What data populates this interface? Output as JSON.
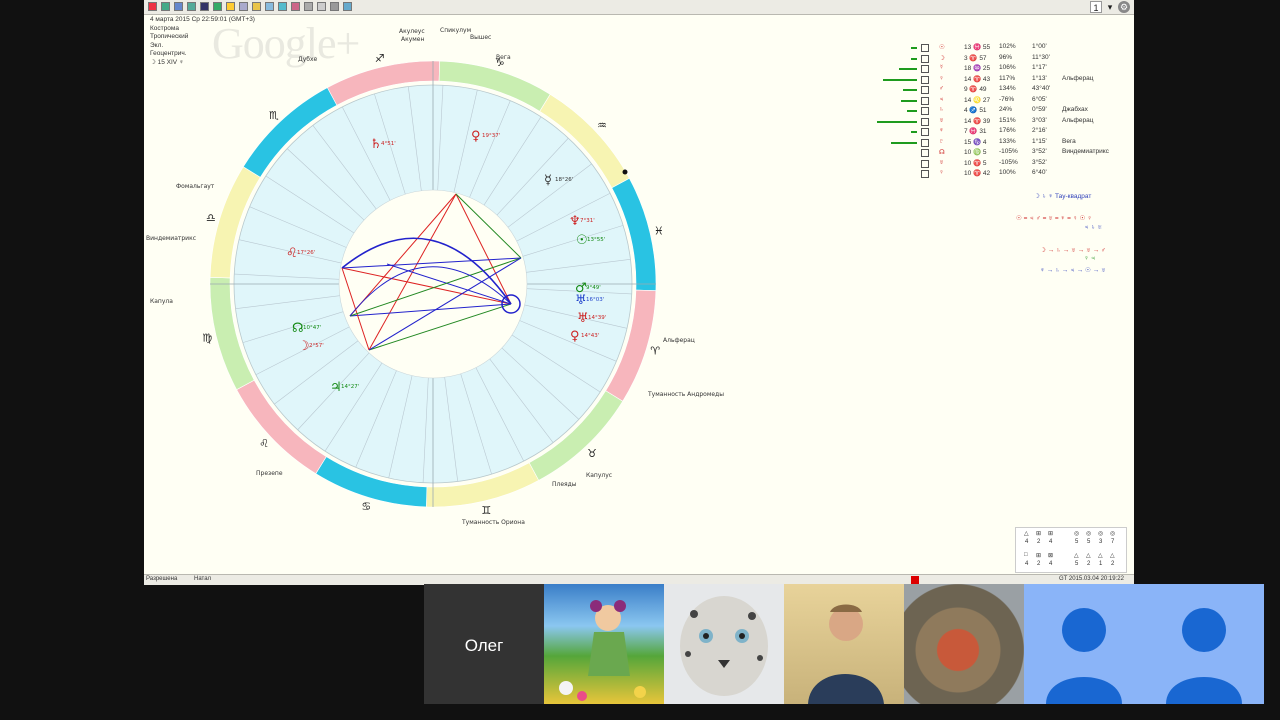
{
  "toolbar": {
    "page_number": "1",
    "icons": [
      "stop-icon",
      "refresh-icon",
      "globe-icon",
      "chart-icon",
      "grid-icon",
      "monitor-icon",
      "star-icon",
      "save-icon",
      "folder-icon",
      "table-icon",
      "grid2-icon",
      "person-icon",
      "list-icon",
      "wrench-icon",
      "print-icon",
      "book-icon"
    ]
  },
  "chart_info": {
    "date_line": "4 марта 2015  Ср  22:59:01 (GMT+3)",
    "line2": "Кострома",
    "line3": "Тропический",
    "line4": "Экл.",
    "line5": "Геоцентрич.",
    "line6": "☽  15 XIV ♆"
  },
  "watermark": "Google+",
  "stars": {
    "aculeus": "Акулеус",
    "acumen": "Акумен",
    "spiculum": "Спикулум",
    "vyshes": "Вышес",
    "dubhe": "Дубхе",
    "vega": "Вега",
    "fomalhaut": "Фомальгаут",
    "vindemiatrix": "Виндемиатрикс",
    "kapula": "Капула",
    "alpheratz": "Альферац",
    "andromeda": "Туманность Андромеды",
    "presepe": "Презепе",
    "kapulus": "Капулус",
    "pleiades": "Плеяды",
    "orion": "Туманность Ориона"
  },
  "planets": [
    {
      "glyph": "♄",
      "label": "4°51'",
      "color": "#cc2222"
    },
    {
      "glyph": "♀",
      "label": "19°37'",
      "color": "#cc2222"
    },
    {
      "glyph": "☿",
      "label": "18°26'",
      "color": "#333333"
    },
    {
      "glyph": "♆",
      "label": "7°31'",
      "color": "#cc2222"
    },
    {
      "glyph": "☉",
      "label": "13°55'",
      "color": "#118811"
    },
    {
      "glyph": "♂",
      "label": "9°49'",
      "color": "#118811"
    },
    {
      "glyph": "♅",
      "label": "16°03'",
      "color": "#2244cc"
    },
    {
      "glyph": "♅",
      "label": "14°39'",
      "color": "#cc2222"
    },
    {
      "glyph": "♀",
      "label": "14°43'",
      "color": "#cc2222"
    },
    {
      "glyph": "♌",
      "label": "17°26'",
      "color": "#cc2222"
    },
    {
      "glyph": "☊",
      "label": "10°47'",
      "color": "#118811"
    },
    {
      "glyph": "☽",
      "label": "2°57'",
      "color": "#cc2222"
    },
    {
      "glyph": "♃",
      "label": "14°27'",
      "color": "#118811"
    }
  ],
  "aspects": [
    {
      "sym": "☉",
      "val": "13 ♓ 55",
      "pct": "102%",
      "orb": "1°00'",
      "star": ""
    },
    {
      "sym": "☽",
      "val": "3 ♈ 57",
      "pct": "96%",
      "orb": "11°30'",
      "star": ""
    },
    {
      "sym": "☿",
      "val": "18 ♒ 25",
      "pct": "106%",
      "orb": "1°17'",
      "star": ""
    },
    {
      "sym": "♀",
      "val": "14 ♈ 43",
      "pct": "117%",
      "orb": "1°13'",
      "star": "Альферац"
    },
    {
      "sym": "♂",
      "val": "9 ♈ 49",
      "pct": "134%",
      "orb": "43°40'",
      "star": ""
    },
    {
      "sym": "♃",
      "val": "14 ♌ 27",
      "pct": "-76%",
      "orb": "6°05'",
      "star": ""
    },
    {
      "sym": "♄",
      "val": "4 ♐ 51",
      "pct": "24%",
      "orb": "0°59'",
      "star": "Джабхах"
    },
    {
      "sym": "♅",
      "val": "14 ♈ 39",
      "pct": "151%",
      "orb": "3°03'",
      "star": "Альферац"
    },
    {
      "sym": "♆",
      "val": "7 ♓ 31",
      "pct": "176%",
      "orb": "2°16'",
      "star": ""
    },
    {
      "sym": "♇",
      "val": "15 ♑ 4",
      "pct": "133%",
      "orb": "1°15'",
      "star": "Вега"
    },
    {
      "sym": "☊",
      "val": "10 ♍ 5",
      "pct": "-105%",
      "orb": "3°52'",
      "star": "Виндемиатрикс"
    },
    {
      "sym": "♅",
      "val": "10 ♈ 5",
      "pct": "-105%",
      "orb": "3°52'",
      "star": ""
    },
    {
      "sym": "♀",
      "val": "10 ♈ 42",
      "pct": "100%",
      "orb": "6°40'",
      "star": ""
    }
  ],
  "patterns": {
    "tau_square": "☽ ♄ ♆  Тау-квадрат",
    "chain1": "☉ = ♃  ♂ = ♅ = ♆ = ♀ ☉ ♀",
    "chain1b": "♃ ♄ ♅",
    "chain2": "☽ → ♄ → ♅ → ♅ → ♂",
    "chain2b": "♀ ♃",
    "chain3": "♆ → ♄ → ♃ → ☉ → ♅"
  },
  "stats": {
    "row1": [
      "4",
      "2",
      "4",
      "5",
      "5",
      "3",
      "7"
    ],
    "row2": [
      "4",
      "2",
      "4",
      "5",
      "2",
      "1",
      "2"
    ]
  },
  "status": {
    "left": "Разрешена",
    "mode": "Натал",
    "right": "GT  2015.03.04 20:19:22"
  },
  "participants": {
    "name": "Олег"
  },
  "colors": {
    "inner_fill": "#e0f6fa",
    "red_line": "#dd2222",
    "blue_line": "#2222cc",
    "green_line": "#228822"
  }
}
